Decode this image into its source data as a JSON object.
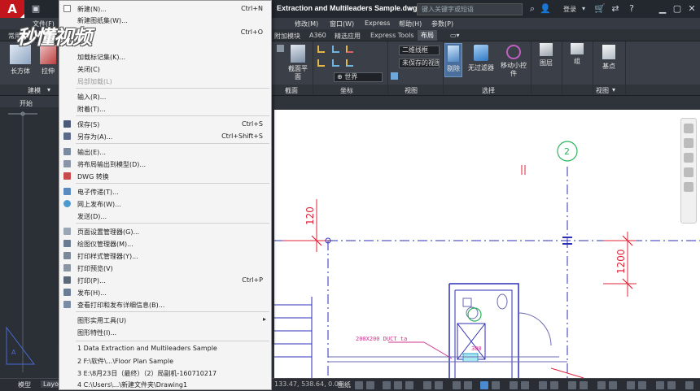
{
  "colors": {
    "title_bar": "#23272e",
    "ribbon": "#3b4048",
    "menu_bg": "#f4f4f4",
    "drawing_bg": "#ffffff",
    "accent_red": "#c3161c",
    "grid_blue": "#2b2fb5",
    "dim_red": "#e0243a",
    "tag_green": "#2db35c",
    "duct_magenta": "#d0308c",
    "lineweight_purple": "#6a6ab0"
  },
  "titlebar": {
    "app_logo": "A",
    "document_title": "Extraction and Multileaders Sample.dwg",
    "search_placeholder": "键入关键字或短语",
    "login_label": "登录"
  },
  "menubar": {
    "items": [
      {
        "label": "修改(M)"
      },
      {
        "label": "窗口(W)"
      },
      {
        "label": "Express"
      },
      {
        "label": "帮助(H)"
      },
      {
        "label": "参数(P)"
      }
    ],
    "left_label": "文件(F)"
  },
  "ribbon_tabs": {
    "left": "常用",
    "items": [
      {
        "label": "附加模块"
      },
      {
        "label": "A360"
      },
      {
        "label": "精选应用"
      },
      {
        "label": "Express Tools"
      },
      {
        "label": "布局",
        "active": true
      }
    ]
  },
  "ribbon": {
    "left_buttons": [
      {
        "label": "长方体"
      },
      {
        "label": "拉伸"
      }
    ],
    "left_panel_title": "建模",
    "view_plane_label": "截面平面",
    "section_panel_title": "截面",
    "combo_style": "二维线框",
    "combo_view": "未保存的视图",
    "combo_world": "世界",
    "coords_panel_title": "坐标",
    "view_panel_title": "视图",
    "select_btn": "剔除",
    "no_filter_btn": "无过滤器",
    "gizmo_btn": "移动小控件",
    "select_panel_title": "选择",
    "layers_btn": "图层",
    "group_btn": "组",
    "basepoint_btn": "基点",
    "view_panel2_title": "视图"
  },
  "left_panel": {
    "start_tab": "开始"
  },
  "app_menu": {
    "items": [
      {
        "label": "新建(N)...",
        "shortcut": "Ctrl+N",
        "icon": "new-icon"
      },
      {
        "label": "新建图纸集(W)...",
        "shortcut": "",
        "icon": ""
      },
      {
        "label": "",
        "shortcut": "Ctrl+O",
        "icon": ""
      },
      {
        "label": "加载标记集(K)...",
        "shortcut": "",
        "icon": ""
      },
      {
        "label": "关闭(C)",
        "shortcut": "",
        "icon": ""
      },
      {
        "label": "局部加载(L)",
        "shortcut": "",
        "icon": "",
        "disabled": true
      },
      {
        "label": "输入(R)...",
        "shortcut": "",
        "icon": ""
      },
      {
        "label": "附着(T)...",
        "shortcut": "",
        "icon": ""
      },
      {
        "label": "保存(S)",
        "shortcut": "Ctrl+S",
        "icon": "save-icon"
      },
      {
        "label": "另存为(A)...",
        "shortcut": "Ctrl+Shift+S",
        "icon": "saveas-icon"
      },
      {
        "label": "输出(E)...",
        "shortcut": "",
        "icon": "export-icon"
      },
      {
        "label": "将布局输出到模型(D)...",
        "shortcut": "",
        "icon": "layout-export-icon"
      },
      {
        "label": "DWG 转换",
        "shortcut": "",
        "icon": "dwg-convert-icon"
      },
      {
        "label": "电子传递(T)...",
        "shortcut": "",
        "icon": "etransmit-icon"
      },
      {
        "label": "网上发布(W)...",
        "shortcut": "",
        "icon": "publish-web-icon"
      },
      {
        "label": "发送(D)...",
        "shortcut": "",
        "icon": ""
      },
      {
        "label": "页面设置管理器(G)...",
        "shortcut": "",
        "icon": "page-setup-icon"
      },
      {
        "label": "绘图仪管理器(M)...",
        "shortcut": "",
        "icon": "plotter-icon"
      },
      {
        "label": "打印样式管理器(Y)...",
        "shortcut": "",
        "icon": "plot-style-icon"
      },
      {
        "label": "打印预览(V)",
        "shortcut": "",
        "icon": "preview-icon"
      },
      {
        "label": "打印(P)...",
        "shortcut": "Ctrl+P",
        "icon": "print-icon"
      },
      {
        "label": "发布(H)...",
        "shortcut": "",
        "icon": "publish-icon"
      },
      {
        "label": "查看打印和发布详细信息(B)...",
        "shortcut": "",
        "icon": "details-icon"
      },
      {
        "label": "图形实用工具(U)",
        "shortcut": "",
        "icon": "",
        "submenu": true
      },
      {
        "label": "图形特性(I)...",
        "shortcut": "",
        "icon": ""
      },
      {
        "label": "1 Data Extraction and Multileaders Sample",
        "shortcut": "",
        "icon": ""
      },
      {
        "label": "2 F:\\软件\\...\\Floor Plan Sample",
        "shortcut": "",
        "icon": ""
      },
      {
        "label": "3 E:\\8月23日（最终）（2）局副机-160710217",
        "shortcut": "",
        "icon": ""
      },
      {
        "label": "4 C:\\Users\\...\\新建文件夹\\Drawing1",
        "shortcut": "",
        "icon": ""
      }
    ],
    "submenu_arrow": "▸"
  },
  "drawing": {
    "grid_tag": "2",
    "dim_left": "120",
    "dim_right": "1200",
    "duct_label": "200X200 DUCT ta",
    "duct_dim": "300"
  },
  "statusbar": {
    "model_tab": "模型",
    "layout_tab": "Layout",
    "coords": "133.47, 538.64, 0.00",
    "paper_label": "图纸"
  },
  "watermark": "秒懂视频"
}
